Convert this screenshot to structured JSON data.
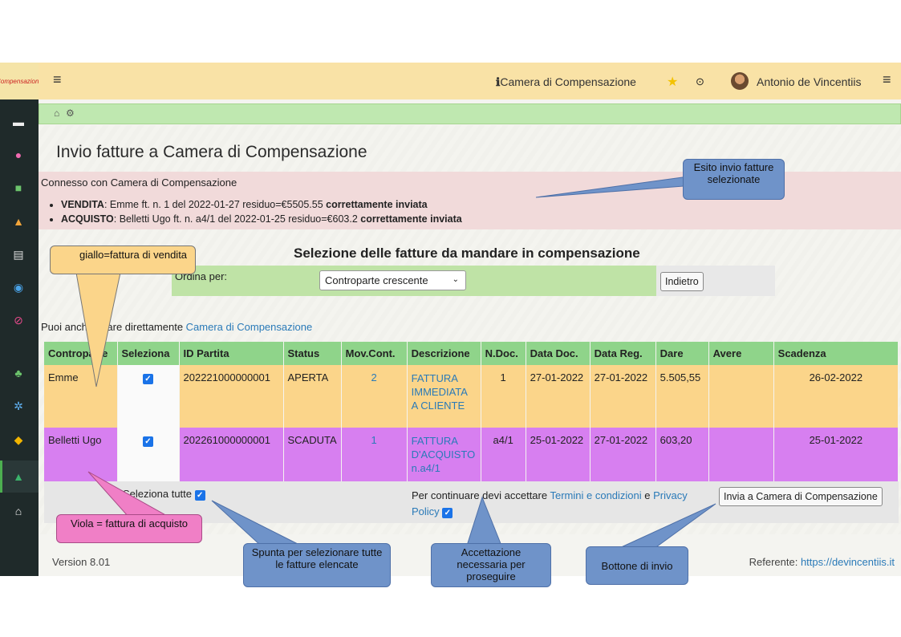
{
  "app": {
    "logo_text": "Compensazione",
    "menu_link": "Camera di Compensazione",
    "user": "Antonio de Vincentiis"
  },
  "sidebar": {
    "icons": [
      "folder-icon",
      "piggy-bank-icon",
      "card-icon",
      "shop-icon",
      "document-icon",
      "database-icon",
      "circle-icon",
      "people-icon",
      "gear-icon",
      "bell-icon",
      "compensation-icon",
      "home-icon"
    ]
  },
  "breadcrumb": {
    "home": "⌂",
    "settings": "⚙"
  },
  "page": {
    "title": "Invio fatture a Camera di Compensazione",
    "message_head": "Connesso con Camera di Compensazione",
    "messages": [
      {
        "type": "VENDITA",
        "text": ": Emme ft. n. 1 del 2022-01-27 residuo=€5505.55 ",
        "status": "correttamente inviata"
      },
      {
        "type": "ACQUISTO",
        "text": ": Belletti Ugo ft. n. a4/1 del 2022-01-25 residuo=€603.2 ",
        "status": "correttamente inviata"
      }
    ],
    "selection_title": "Selezione delle fatture da mandare in compensazione",
    "order_label": "Ordina per:",
    "order_value": "Controparte crescente",
    "back_button": "Indietro",
    "use_direct_prefix": "Puoi anche usare direttamente ",
    "use_direct_link": "Camera di Compensazione"
  },
  "table": {
    "headers": [
      "Controparte",
      "Seleziona",
      "ID Partita",
      "Status",
      "Mov.Cont.",
      "Descrizione",
      "N.Doc.",
      "Data Doc.",
      "Data Reg.",
      "Dare",
      "Avere",
      "Scadenza"
    ],
    "rows": [
      {
        "controparte": "Emme",
        "id": "202221000000001",
        "status": "APERTA",
        "mov": "2",
        "descr": "FATTURA IMMEDIATA A CLIENTE",
        "ndoc": "1",
        "datadoc": "27-01-2022",
        "datareg": "27-01-2022",
        "dare": "5.505,55",
        "avere": "",
        "scadenza": "26-02-2022"
      },
      {
        "controparte": "Belletti Ugo",
        "id": "202261000000001",
        "status": "SCADUTA",
        "mov": "1",
        "descr": "FATTURA D'ACQUISTO n.a4/1",
        "ndoc": "a4/1",
        "datadoc": "25-01-2022",
        "datareg": "27-01-2022",
        "dare": "603,20",
        "avere": "",
        "scadenza": "25-01-2022"
      }
    ]
  },
  "bottom": {
    "select_all": "Seleziona tutte",
    "accept_prefix": "Per continuare devi accettare ",
    "terms": "Termini e condizioni",
    "and": " e ",
    "privacy_1": "Privacy",
    "privacy_2": "Policy",
    "send_button": "Invia a Camera di Compensazione"
  },
  "footer": {
    "version": "Version 8.01",
    "ref_prefix": "Referente: ",
    "ref_link": "https://devincentiis.it"
  },
  "callouts": {
    "esito": "Esito invio fatture selezionate",
    "giallo": "giallo=fattura di vendita",
    "viola": "Viola = fattura di acquisto",
    "spunta": "Spunta per selezionare tutte le fatture elencate",
    "accettazione": "Accettazione necessaria per proseguire",
    "bottone": "Bottone di invio"
  },
  "colors": {
    "topbar": "#f9e2a6",
    "vendita": "#fbd58a",
    "acquisto": "#d77ff0",
    "header": "#8fd48a",
    "callout_blue": "#6f93c9"
  }
}
